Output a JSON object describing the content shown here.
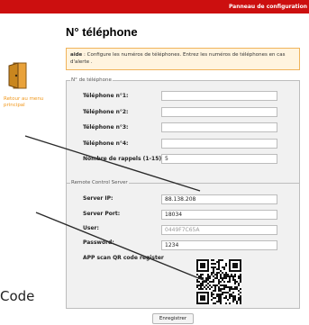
{
  "header": {
    "title": "Panneau de configuration"
  },
  "page": {
    "title": "N° téléphone"
  },
  "help": {
    "label": "aide",
    "text": " : Configure les numéros de téléphones. Entrez les numéros de téléphones en cas d'alerte ."
  },
  "sidebar": {
    "back_link": "Retour au menu principal",
    "icon": "door-icon"
  },
  "phone_section": {
    "legend": "N° de téléphone",
    "fields": [
      {
        "label": "Téléphone n°1:",
        "value": ""
      },
      {
        "label": "Téléphone n°2:",
        "value": ""
      },
      {
        "label": "Téléphone n°3:",
        "value": ""
      },
      {
        "label": "Téléphone n°4:",
        "value": ""
      },
      {
        "label": "Nombre de rappels (1-15):",
        "value": "5"
      }
    ]
  },
  "remote_section": {
    "legend": "Remote Control Server",
    "server_ip": {
      "label": "Server IP:",
      "value": "88.138.208"
    },
    "server_port": {
      "label": "Server Port:",
      "value": "18034"
    },
    "user": {
      "label": "User:",
      "value": "0449F7C65A"
    },
    "password": {
      "label": "Password:",
      "value": "1234"
    },
    "qr_label": "APP scan QR code register"
  },
  "actions": {
    "save_label": "Enregistrer"
  },
  "annotation": {
    "label": "Code"
  },
  "colors": {
    "header_bg": "#cc0f0f",
    "help_border": "#f0b35a",
    "link": "#f0961a"
  }
}
